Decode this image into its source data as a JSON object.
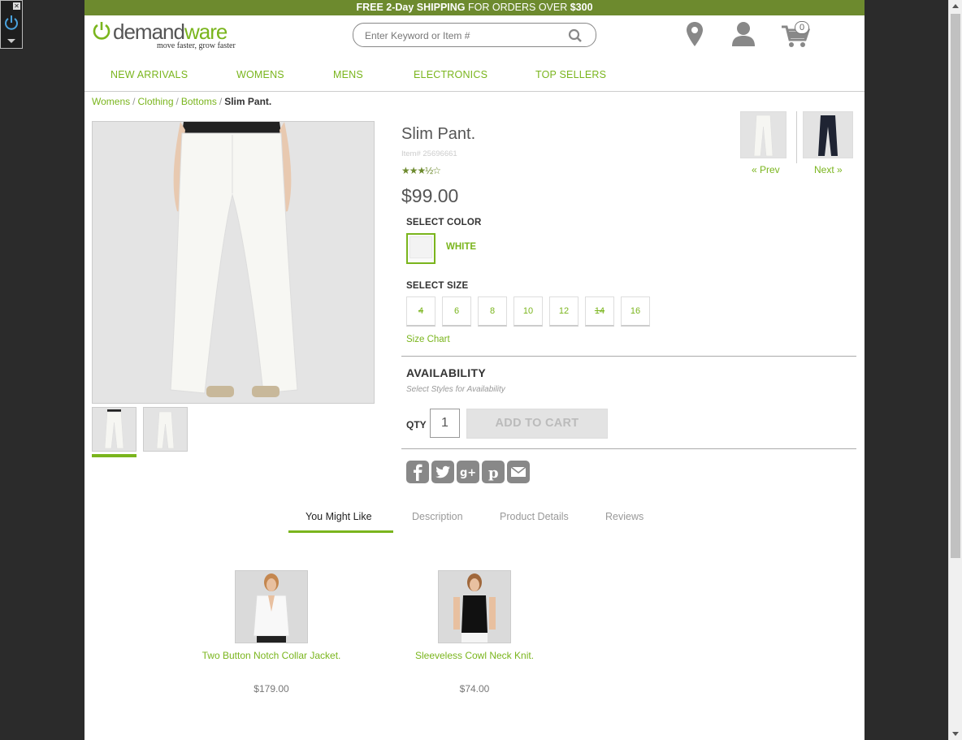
{
  "promo": {
    "bold1": "FREE 2-Day ",
    "bold2": "SHIPPING",
    "rest": " FOR ORDERS OVER ",
    "amount": "$300"
  },
  "logo": {
    "word1": "demand",
    "word2": "ware",
    "tagline": "move faster, grow faster"
  },
  "search": {
    "placeholder": "Enter Keyword or Item #"
  },
  "header": {
    "cart_count": "0"
  },
  "nav": [
    "NEW ARRIVALS",
    "WOMENS",
    "MENS",
    "ELECTRONICS",
    "TOP SELLERS"
  ],
  "breadcrumb": {
    "items": [
      "Womens",
      "Clothing",
      "Bottoms"
    ],
    "sep": "/",
    "current": "Slim Pant."
  },
  "product": {
    "name": "Slim Pant.",
    "item_number": "Item# 25696661",
    "rating_stars": "★★★½☆",
    "rating": 3.5,
    "price": "$99.00",
    "select_color_label": "SELECT COLOR",
    "color": "WHITE",
    "select_size_label": "SELECT SIZE",
    "sizes": [
      "4",
      "6",
      "8",
      "10",
      "12",
      "14",
      "16"
    ],
    "size_chart": "Size Chart",
    "availability_title": "AVAILABILITY",
    "availability_sub": "Select Styles for Availability",
    "qty_label": "QTY",
    "qty": "1",
    "add_to_cart": "ADD TO CART"
  },
  "prev_next": {
    "prev": "« Prev",
    "next": "Next »"
  },
  "tabs": [
    "You Might Like",
    "Description",
    "Product Details",
    "Reviews"
  ],
  "recommendations": [
    {
      "name": "Two Button Notch Collar Jacket.",
      "price": "$179.00"
    },
    {
      "name": "Sleeveless Cowl Neck Knit.",
      "price": "$74.00"
    }
  ],
  "colors": {
    "accent": "#7ab51d",
    "promo_bg": "#6d8a2e"
  }
}
